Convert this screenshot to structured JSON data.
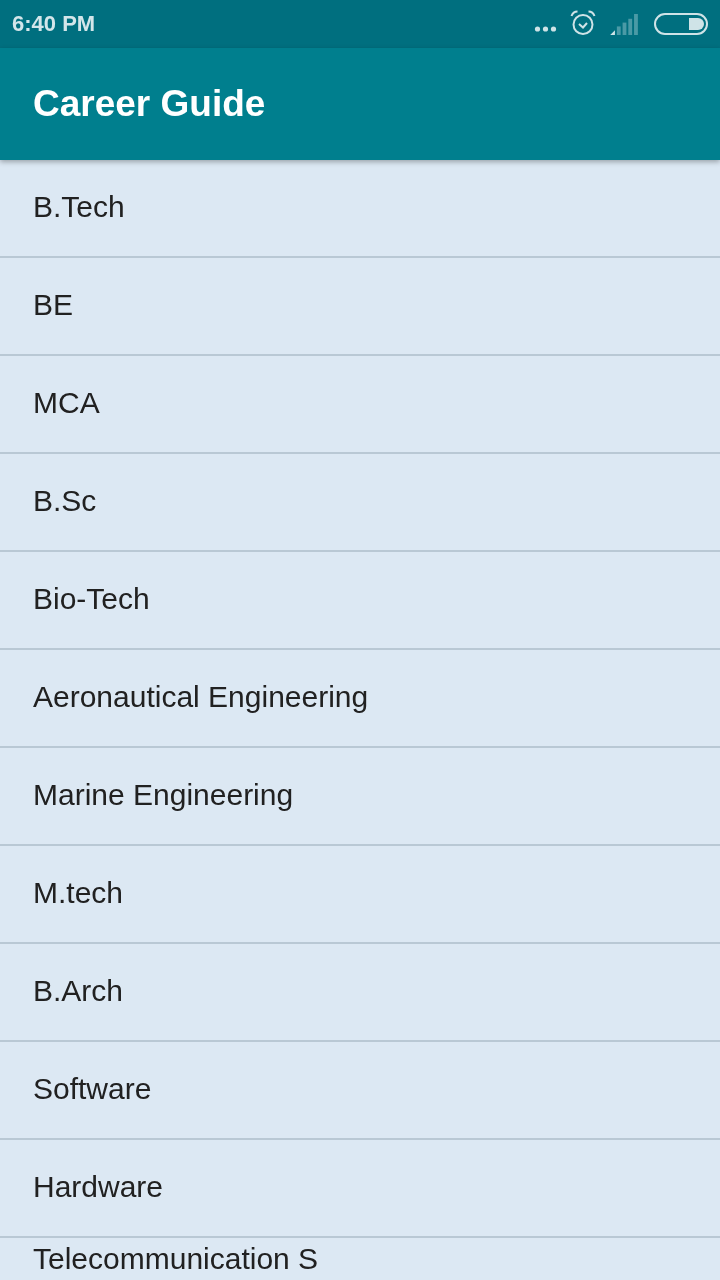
{
  "status_bar": {
    "time": "6:40 PM"
  },
  "app_bar": {
    "title": "Career Guide"
  },
  "courses": [
    "B.Tech",
    "BE",
    "MCA",
    "B.Sc",
    "Bio-Tech",
    "Aeronautical Engineering",
    "Marine Engineering",
    "M.tech",
    "B.Arch",
    "Software",
    "Hardware",
    "Telecommunication S"
  ]
}
